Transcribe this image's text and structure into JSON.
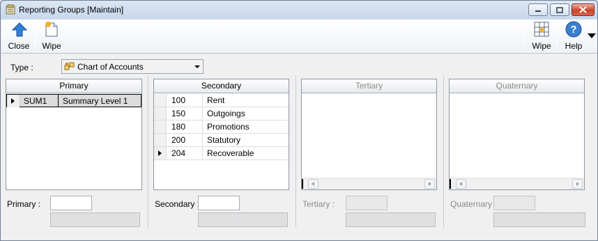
{
  "window": {
    "title": "Reporting Groups [Maintain]"
  },
  "toolbar": {
    "close_label": "Close",
    "wipe_label": "Wipe",
    "wipe2_label": "Wipe",
    "help_label": "Help"
  },
  "type": {
    "label": "Type :",
    "value": "Chart of Accounts"
  },
  "primary": {
    "header": "Primary",
    "rows": [
      {
        "code": "SUM1",
        "name": "Summary Level 1"
      }
    ],
    "field_label": "Primary :",
    "code_value": "",
    "description_value": ""
  },
  "secondary": {
    "header": "Secondary",
    "rows": [
      {
        "code": "100",
        "name": "Rent"
      },
      {
        "code": "150",
        "name": "Outgoings"
      },
      {
        "code": "180",
        "name": "Promotions"
      },
      {
        "code": "200",
        "name": "Statutory"
      },
      {
        "code": "204",
        "name": "Recoverable"
      }
    ],
    "field_label": "Secondary :",
    "code_value": "",
    "description_value": ""
  },
  "tertiary": {
    "header": "Tertiary",
    "field_label": "Tertiary :",
    "code_value": "",
    "description_value": ""
  },
  "quaternary": {
    "header": "Quaternary",
    "field_label": "Quaternary :",
    "code_value": "",
    "description_value": ""
  },
  "colors": {
    "selected_row": "#dcdcdc",
    "toolbar_icon_blue": "#2f7fd6",
    "help_blue": "#3b7fcf"
  }
}
